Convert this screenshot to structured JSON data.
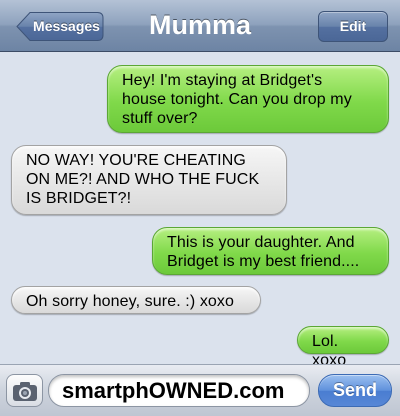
{
  "navbar": {
    "back_label": "Messages",
    "title": "Mumma",
    "edit_label": "Edit"
  },
  "messages": [
    {
      "direction": "outgoing",
      "lines": [
        "Hey! I'm staying at Bridget's",
        "house tonight. Can you drop my",
        "stuff over?"
      ]
    },
    {
      "direction": "incoming",
      "lines": [
        "NO WAY! YOU'RE CHEATING",
        "ON ME?! AND WHO THE FUCK",
        "IS BRIDGET?!"
      ]
    },
    {
      "direction": "outgoing",
      "lines": [
        "This is your daughter. And",
        "Bridget is my best friend...."
      ]
    },
    {
      "direction": "incoming",
      "lines": [
        "Oh sorry honey, sure. :) xoxo"
      ]
    },
    {
      "direction": "outgoing",
      "lines": [
        "Lol. xoxo"
      ]
    }
  ],
  "compose": {
    "camera_icon": "camera-icon",
    "input_value": "smartphOWNED.com",
    "send_label": "Send"
  },
  "colors": {
    "outgoing_bubble": "#80d94a",
    "incoming_bubble": "#e6e6e6",
    "background": "#dbe2ed",
    "nav_bar": "#8ea2bd",
    "send_button": "#5f91dc"
  }
}
